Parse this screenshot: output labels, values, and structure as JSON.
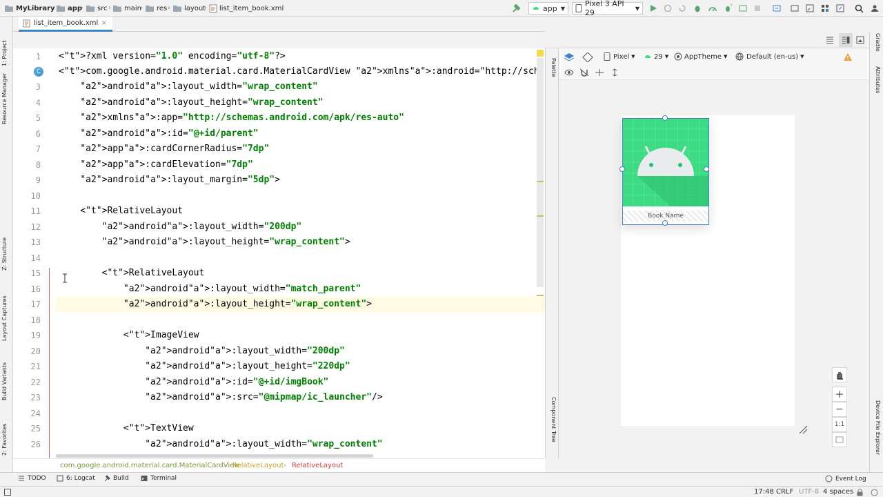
{
  "nav": {
    "breadcrumbs": [
      "MyLibrary",
      "app",
      "src",
      "main",
      "res",
      "layout",
      "list_item_book.xml"
    ],
    "run_config": "app",
    "device": "Pixel 3 API 29"
  },
  "editor_tab": {
    "label": "list_item_book.xml"
  },
  "left_tools": [
    "1: Project",
    "Resource Manager",
    "Z: Structure",
    "Layout Captures",
    "Build Variants",
    "2: Favorites"
  ],
  "right_tools": [
    "Gradle",
    "Attributes",
    "Device File Explorer"
  ],
  "side_labels": {
    "palette": "Palette",
    "component_tree": "Component Tree"
  },
  "code": {
    "line_numbers": [
      "1",
      "2",
      "3",
      "4",
      "5",
      "6",
      "7",
      "8",
      "9",
      "10",
      "11",
      "12",
      "13",
      "14",
      "15",
      "16",
      "17",
      "18",
      "19",
      "20",
      "21",
      "22",
      "23",
      "24",
      "25",
      "26"
    ],
    "lines": [
      "<?xml version=\"1.0\" encoding=\"utf-8\"?>",
      "<com.google.android.material.card.MaterialCardView xmlns:android=\"http://sch",
      "    android:layout_width=\"wrap_content\"",
      "    android:layout_height=\"wrap_content\"",
      "    xmlns:app=\"http://schemas.android.com/apk/res-auto\"",
      "    android:id=\"@+id/parent\"",
      "    app:cardCornerRadius=\"7dp\"",
      "    app:cardElevation=\"7dp\"",
      "    android:layout_margin=\"5dp\">",
      "",
      "    <RelativeLayout",
      "        android:layout_width=\"200dp\"",
      "        android:layout_height=\"wrap_content\">",
      "",
      "        <RelativeLayout",
      "            android:layout_width=\"match_parent\"",
      "            android:layout_height=\"wrap_content\">",
      "",
      "            <ImageView",
      "                android:layout_width=\"200dp\"",
      "                android:layout_height=\"220dp\"",
      "                android:id=\"@+id/imgBook\"",
      "                android:src=\"@mipmap/ic_launcher\"/>",
      "",
      "            <TextView",
      "                android:layout_width=\"wrap_content\""
    ],
    "current_line": "17",
    "class_marker": "C"
  },
  "code_breadcrumb": [
    "com.google.android.material.card.MaterialCardView",
    "RelativeLayout",
    "RelativeLayout"
  ],
  "design_toolbar": {
    "device": "Pixel",
    "api": "29",
    "theme": "AppTheme",
    "locale": "Default (en-us)"
  },
  "preview": {
    "text": "Book Name"
  },
  "zoom_controls": [
    "+",
    "−",
    "1:1"
  ],
  "bottom_tools": [
    "TODO",
    "6: Logcat",
    "Build",
    "Terminal"
  ],
  "event_log": "Event Log",
  "status": {
    "position": "17:48",
    "line_sep": "CRLF",
    "encoding": "UTF-8",
    "indent": "4 spaces"
  },
  "colors": {
    "tag": "#000080",
    "attr": "#660e7a",
    "string": "#008000",
    "android_green": "#3ddc84",
    "accent": "#4083c9"
  }
}
